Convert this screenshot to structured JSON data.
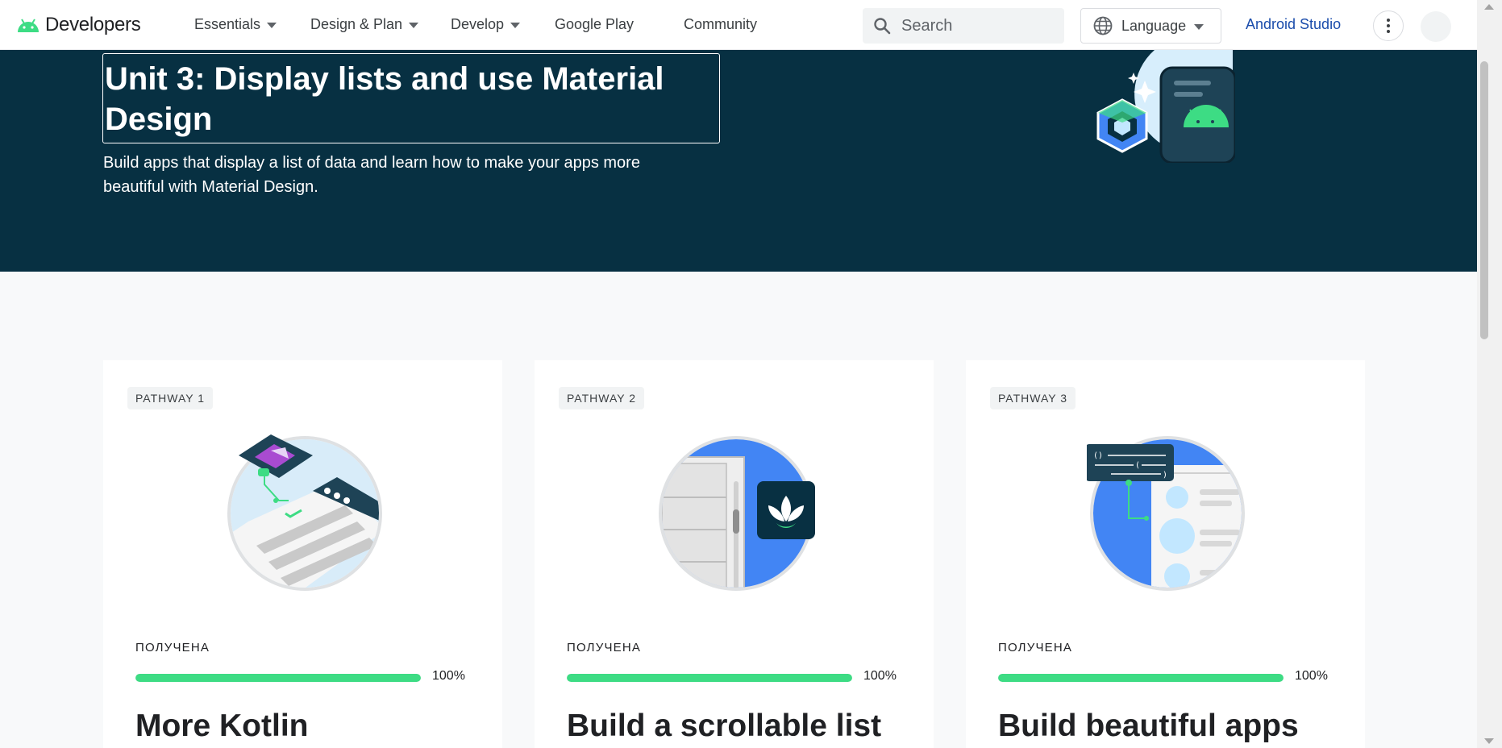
{
  "brand": {
    "name": "Developers"
  },
  "nav": {
    "items": [
      {
        "label": "Essentials",
        "dropdown": true
      },
      {
        "label": "Design & Plan",
        "dropdown": true
      },
      {
        "label": "Develop",
        "dropdown": true
      },
      {
        "label": "Google Play",
        "dropdown": false
      },
      {
        "label": "Community",
        "dropdown": false
      }
    ],
    "search_placeholder": "Search",
    "language_label": "Language",
    "studio_link": "Android Studio"
  },
  "hero": {
    "title": "Unit 3: Display lists and use Material Design",
    "description": "Build apps that display a list of data and learn how to make your apps more beautiful with Material Design."
  },
  "pathways": [
    {
      "badge": "PATHWAY 1",
      "status": "ПОЛУЧЕНА",
      "progress": 100,
      "progress_label": "100%",
      "title": "More Kotlin"
    },
    {
      "badge": "PATHWAY 2",
      "status": "ПОЛУЧЕНА",
      "progress": 100,
      "progress_label": "100%",
      "title": "Build a scrollable list"
    },
    {
      "badge": "PATHWAY 3",
      "status": "ПОЛУЧЕНА",
      "progress": 100,
      "progress_label": "100%",
      "title": "Build beautiful apps"
    }
  ],
  "colors": {
    "hero_bg": "#073042",
    "android_green": "#3ddc84",
    "link_blue": "#1a4cab",
    "page_bg": "#f8f9fa"
  }
}
